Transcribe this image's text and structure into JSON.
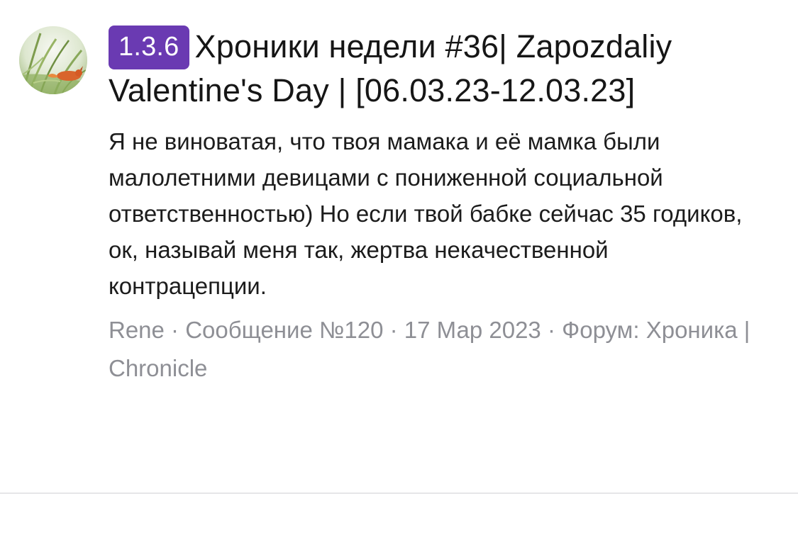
{
  "post": {
    "badge": "1.3.6",
    "title": "Хроники недели #36| Zapozdaliy Valentine's Day | [06.03.23-12.03.23]",
    "body": "Я не виноватая, что твоя мамака и её мамка были малолетними девицами с пониженной социальной ответственностью) Но если твой бабке сейчас 35 годиков, ок, называй меня так, жертва некачественной контрацепции.",
    "meta": {
      "author": "Rene",
      "separator": " · ",
      "message": "Сообщение №120",
      "date": "17 Мар 2023",
      "forum_label": "Форум:",
      "forum_name": "Хроника | Chronicle"
    }
  },
  "colors": {
    "badge_bg": "#6a3ab2",
    "meta_text": "#8e8f95",
    "divider": "#e6e6e8"
  },
  "icons": {
    "avatar": "avatar-grass-fox-image"
  }
}
